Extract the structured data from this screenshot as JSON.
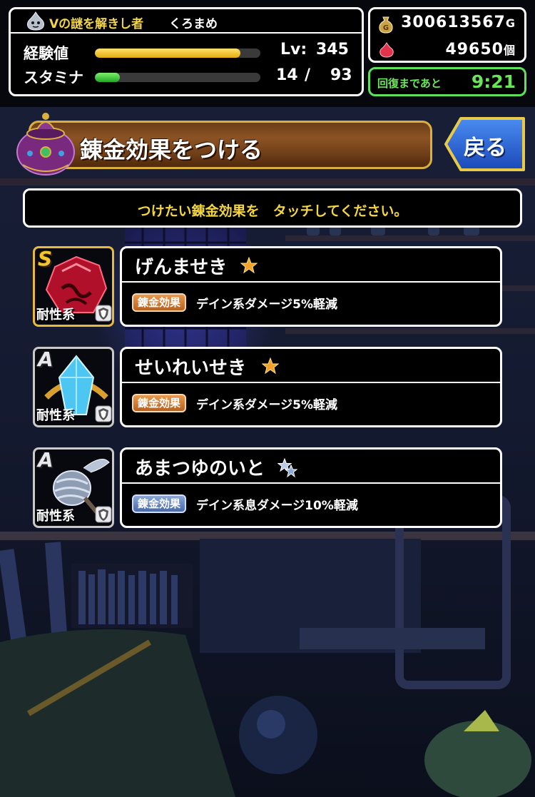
{
  "status": {
    "title": "Vの謎を解きし者",
    "name": "くろまめ",
    "exp_label": "経験値",
    "exp_fill": 0.88,
    "level_label": "Lv:",
    "level_value": "345",
    "stamina_label": "スタミナ",
    "stamina_fill": 0.15,
    "stamina_current": "14",
    "stamina_sep": "/",
    "stamina_max": "93"
  },
  "currency": {
    "gold_value": "300613567",
    "gold_unit": "G",
    "gem_value": "49650",
    "gem_unit": "個"
  },
  "recovery": {
    "label": "回復まであと",
    "time": "9:21"
  },
  "header": {
    "title": "錬金効果をつける",
    "back_label": "戻る"
  },
  "instruction": "つけたい錬金効果を　タッチしてください。",
  "items": [
    {
      "rank": "S",
      "name": "げんませき",
      "type_label": "耐性系",
      "tag": "錬金効果",
      "effect": "デイン系ダメージ5%軽減",
      "star": "gold-star-icon",
      "art": "red-gem"
    },
    {
      "rank": "A",
      "name": "せいれいせき",
      "type_label": "耐性系",
      "tag": "錬金効果",
      "effect": "デイン系ダメージ5%軽減",
      "star": "gold-star-icon",
      "art": "blue-crystal"
    },
    {
      "rank": "A",
      "name": "あまつゆのいと",
      "type_label": "耐性系",
      "tag": "錬金効果",
      "effect": "デイン系息ダメージ10%軽減",
      "star": "silver-double-star-icon",
      "art": "silver-thread"
    }
  ],
  "colors": {
    "exp_bar": "#f4c620",
    "stamina_bar": "#38d13a",
    "accent_yellow": "#f4d73e",
    "accent_green": "#6ae55a"
  }
}
